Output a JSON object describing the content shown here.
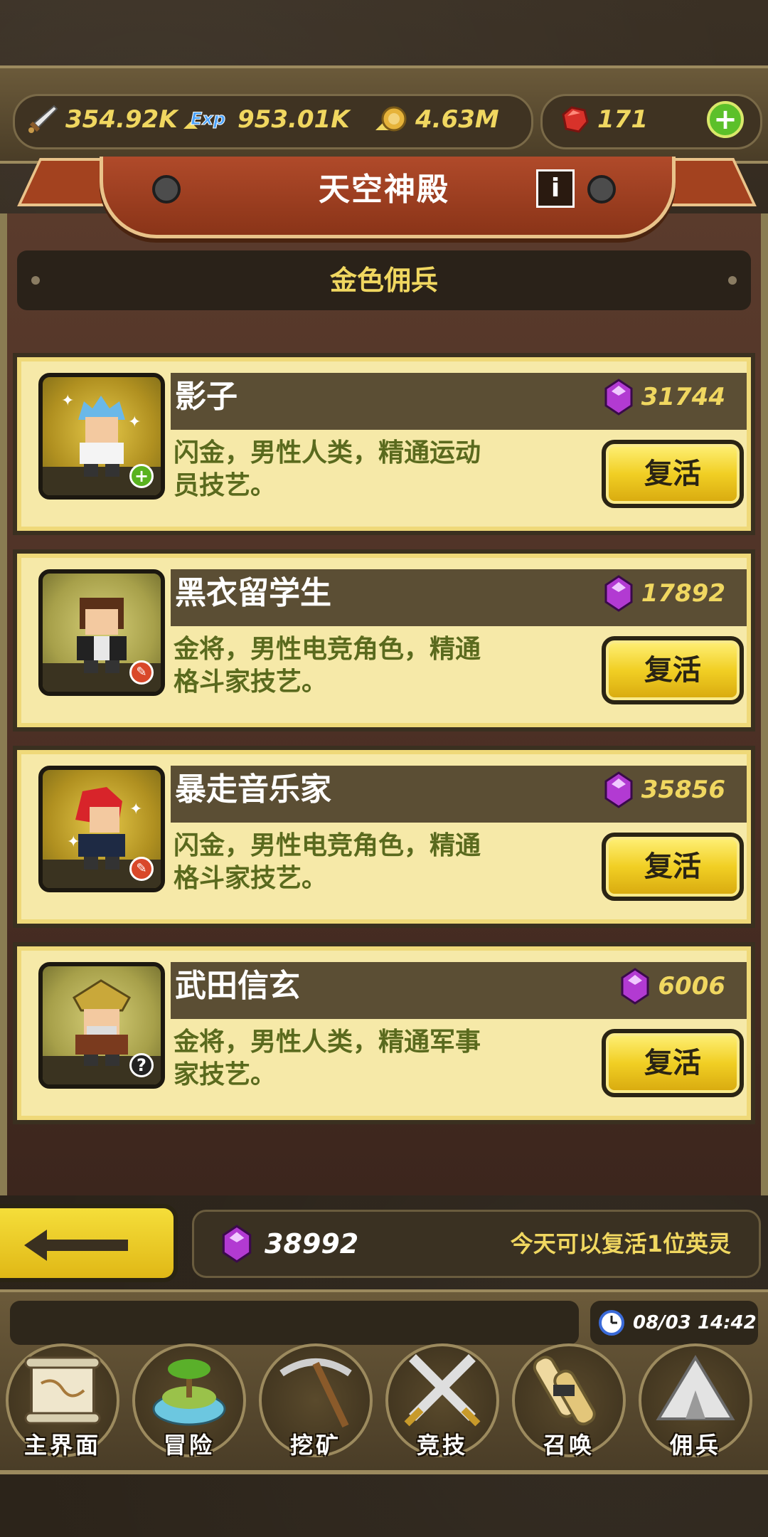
{
  "resources": {
    "attack": "354.92K",
    "exp": "953.01K",
    "gold": "4.63M",
    "ruby": "171",
    "add_label": "+"
  },
  "banner": {
    "title": "天空神殿",
    "info_label": "i"
  },
  "section": {
    "subtitle": "金色佣兵"
  },
  "heroes": [
    {
      "name": "影子",
      "cost": "31744",
      "desc_line1": "闪金，男性人类，精通运动",
      "desc_line2": "员技艺。",
      "button": "复活",
      "badge": "+"
    },
    {
      "name": "黑衣留学生",
      "cost": "17892",
      "desc_line1": "金将，男性电竞角色，精通",
      "desc_line2": "格斗家技艺。",
      "button": "复活",
      "badge": ""
    },
    {
      "name": "暴走音乐家",
      "cost": "35856",
      "desc_line1": "闪金，男性电竞角色，精通",
      "desc_line2": "格斗家技艺。",
      "button": "复活",
      "badge": ""
    },
    {
      "name": "武田信玄",
      "cost": "6006",
      "desc_line1": "金将，男性人类，精通军事",
      "desc_line2": "家技艺。",
      "button": "复活",
      "badge": "?"
    }
  ],
  "footer": {
    "total_gems": "38992",
    "revive_note": "今天可以复活1位英灵"
  },
  "clock": "08/03 14:42",
  "nav": [
    {
      "label": "主界面"
    },
    {
      "label": "冒险"
    },
    {
      "label": "挖矿"
    },
    {
      "label": "竞技"
    },
    {
      "label": "召唤"
    },
    {
      "label": "佣兵"
    }
  ],
  "colors": {
    "accent_gold": "#f0d760",
    "card_bg": "#f6e9a8",
    "banner_red": "#b04a2a",
    "desc_green": "#5a6a1e",
    "gem_purple": "#b23ad2"
  }
}
